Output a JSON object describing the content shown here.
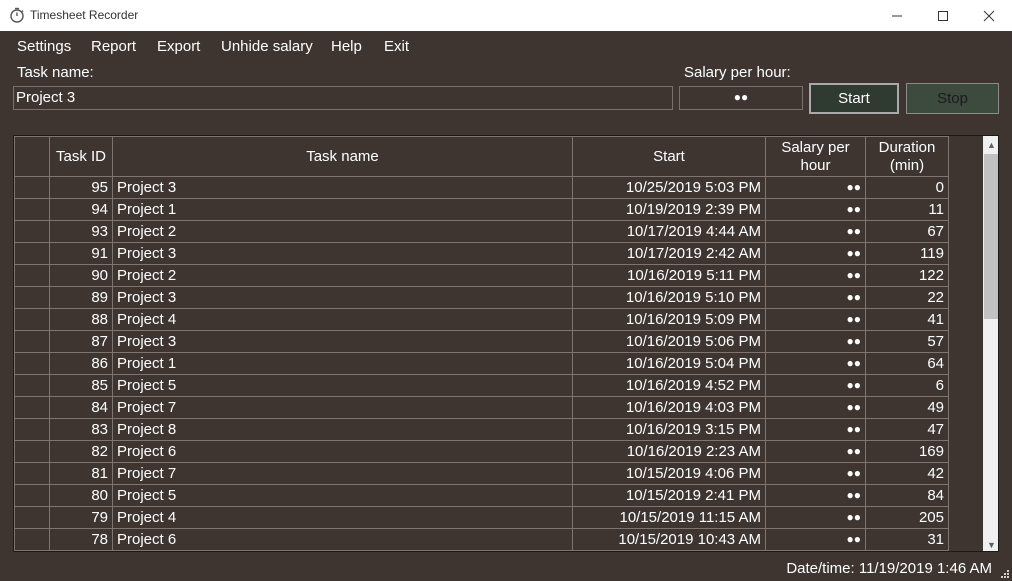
{
  "window": {
    "title": "Timesheet Recorder"
  },
  "menu": [
    "Settings",
    "Report",
    "Export",
    "Unhide salary",
    "Help",
    "Exit"
  ],
  "form": {
    "task_name_label": "Task name:",
    "task_name_value": "Project 3",
    "salary_label": "Salary per hour:",
    "salary_value": "●●",
    "start_label": "Start",
    "stop_label": "Stop"
  },
  "table": {
    "headers": {
      "id": "Task ID",
      "name": "Task name",
      "start": "Start",
      "salary_1": "Salary per",
      "salary_2": "hour",
      "duration_1": "Duration",
      "duration_2": "(min)"
    },
    "rows": [
      {
        "id": "95",
        "name": "Project 3",
        "start": "10/25/2019 5:03 PM",
        "salary": "●●",
        "duration": "0"
      },
      {
        "id": "94",
        "name": "Project 1",
        "start": "10/19/2019 2:39 PM",
        "salary": "●●",
        "duration": "11"
      },
      {
        "id": "93",
        "name": "Project 2",
        "start": "10/17/2019 4:44 AM",
        "salary": "●●",
        "duration": "67"
      },
      {
        "id": "91",
        "name": "Project 3",
        "start": "10/17/2019 2:42 AM",
        "salary": "●●",
        "duration": "119"
      },
      {
        "id": "90",
        "name": "Project 2",
        "start": "10/16/2019 5:11 PM",
        "salary": "●●",
        "duration": "122"
      },
      {
        "id": "89",
        "name": "Project 3",
        "start": "10/16/2019 5:10 PM",
        "salary": "●●",
        "duration": "22"
      },
      {
        "id": "88",
        "name": "Project 4",
        "start": "10/16/2019 5:09 PM",
        "salary": "●●",
        "duration": "41"
      },
      {
        "id": "87",
        "name": "Project 3",
        "start": "10/16/2019 5:06 PM",
        "salary": "●●",
        "duration": "57"
      },
      {
        "id": "86",
        "name": "Project 1",
        "start": "10/16/2019 5:04 PM",
        "salary": "●●",
        "duration": "64"
      },
      {
        "id": "85",
        "name": "Project 5",
        "start": "10/16/2019 4:52 PM",
        "salary": "●●",
        "duration": "6"
      },
      {
        "id": "84",
        "name": "Project 7",
        "start": "10/16/2019 4:03 PM",
        "salary": "●●",
        "duration": "49"
      },
      {
        "id": "83",
        "name": "Project 8",
        "start": "10/16/2019 3:15 PM",
        "salary": "●●",
        "duration": "47"
      },
      {
        "id": "82",
        "name": "Project 6",
        "start": "10/16/2019 2:23 AM",
        "salary": "●●",
        "duration": "169"
      },
      {
        "id": "81",
        "name": "Project 7",
        "start": "10/15/2019 4:06 PM",
        "salary": "●●",
        "duration": "42"
      },
      {
        "id": "80",
        "name": "Project 5",
        "start": "10/15/2019 2:41 PM",
        "salary": "●●",
        "duration": "84"
      },
      {
        "id": "79",
        "name": "Project 4",
        "start": "10/15/2019 11:15 AM",
        "salary": "●●",
        "duration": "205"
      },
      {
        "id": "78",
        "name": "Project 6",
        "start": "10/15/2019 10:43 AM",
        "salary": "●●",
        "duration": "31"
      }
    ]
  },
  "status": {
    "datetime": "Date/time: 11/19/2019 1:46 AM"
  },
  "colors": {
    "background": "#3e3531",
    "start_button": "#2f3a30",
    "stop_button": "#3d4a3e",
    "grid_lines": "#7e7571"
  },
  "icons": [
    "stopwatch-icon",
    "minimize-icon",
    "maximize-icon",
    "close-icon",
    "scroll-up-icon",
    "scroll-down-icon",
    "resize-grip-icon"
  ]
}
